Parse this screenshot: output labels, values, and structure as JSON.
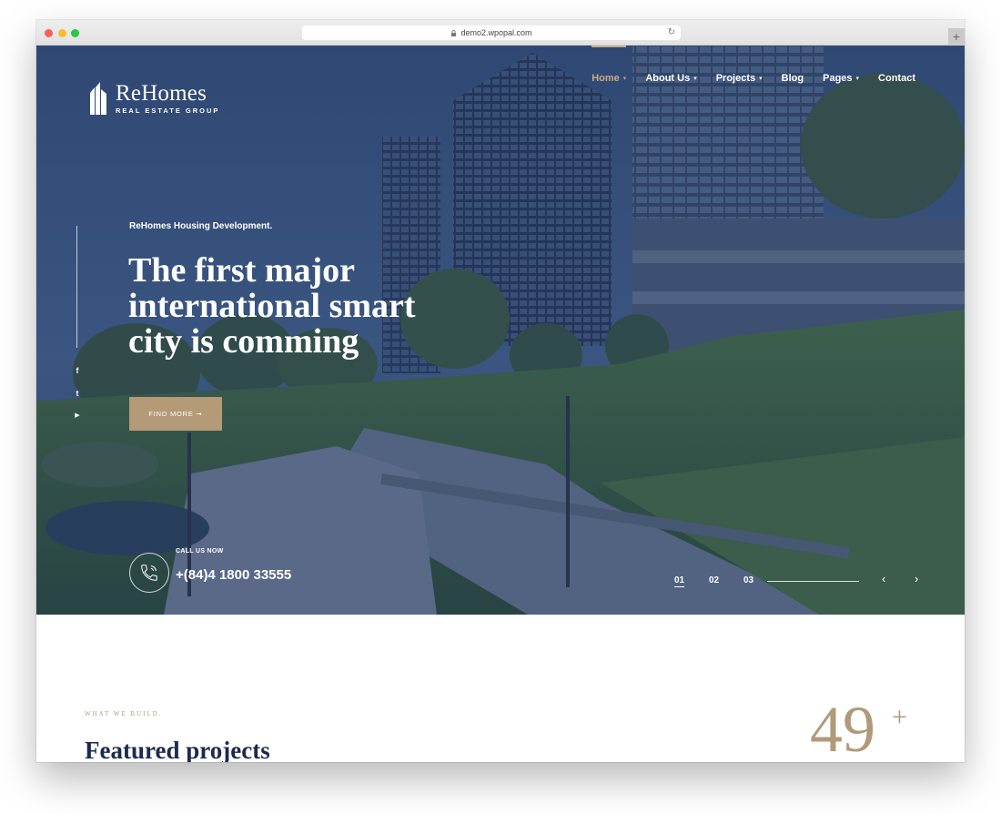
{
  "browser": {
    "url": "demo2.wpopal.com"
  },
  "header": {
    "logo_name": "ReHomes",
    "logo_tagline": "REAL ESTATE GROUP",
    "nav": [
      {
        "label": "Home",
        "dropdown": true,
        "active": true
      },
      {
        "label": "About Us",
        "dropdown": true,
        "active": false
      },
      {
        "label": "Projects",
        "dropdown": true,
        "active": false
      },
      {
        "label": "Blog",
        "dropdown": false,
        "active": false
      },
      {
        "label": "Pages",
        "dropdown": true,
        "active": false
      },
      {
        "label": "Contact",
        "dropdown": false,
        "active": false
      }
    ]
  },
  "social": {
    "facebook": "f",
    "twitter": "t",
    "youtube": "▶"
  },
  "hero": {
    "eyebrow": "ReHomes Housing Development.",
    "headline_line1": "The first major",
    "headline_line2": "international smart",
    "headline_line3": "city is comming",
    "button_label": "FIND MORE ➞",
    "call_label": "CALL US NOW",
    "phone": "+(84)4 1800 33555",
    "slides": [
      "01",
      "02",
      "03"
    ],
    "active_slide": "01",
    "prev_arrow": "‹",
    "next_arrow": "›"
  },
  "featured": {
    "eyebrow": "WHAT WE BUILD.",
    "title": "Featured projects",
    "counter": "49",
    "counter_suffix": "+"
  },
  "colors": {
    "accent": "#b49a76",
    "navy": "#1c2a4d",
    "hero_overlay": "#2e4368"
  }
}
